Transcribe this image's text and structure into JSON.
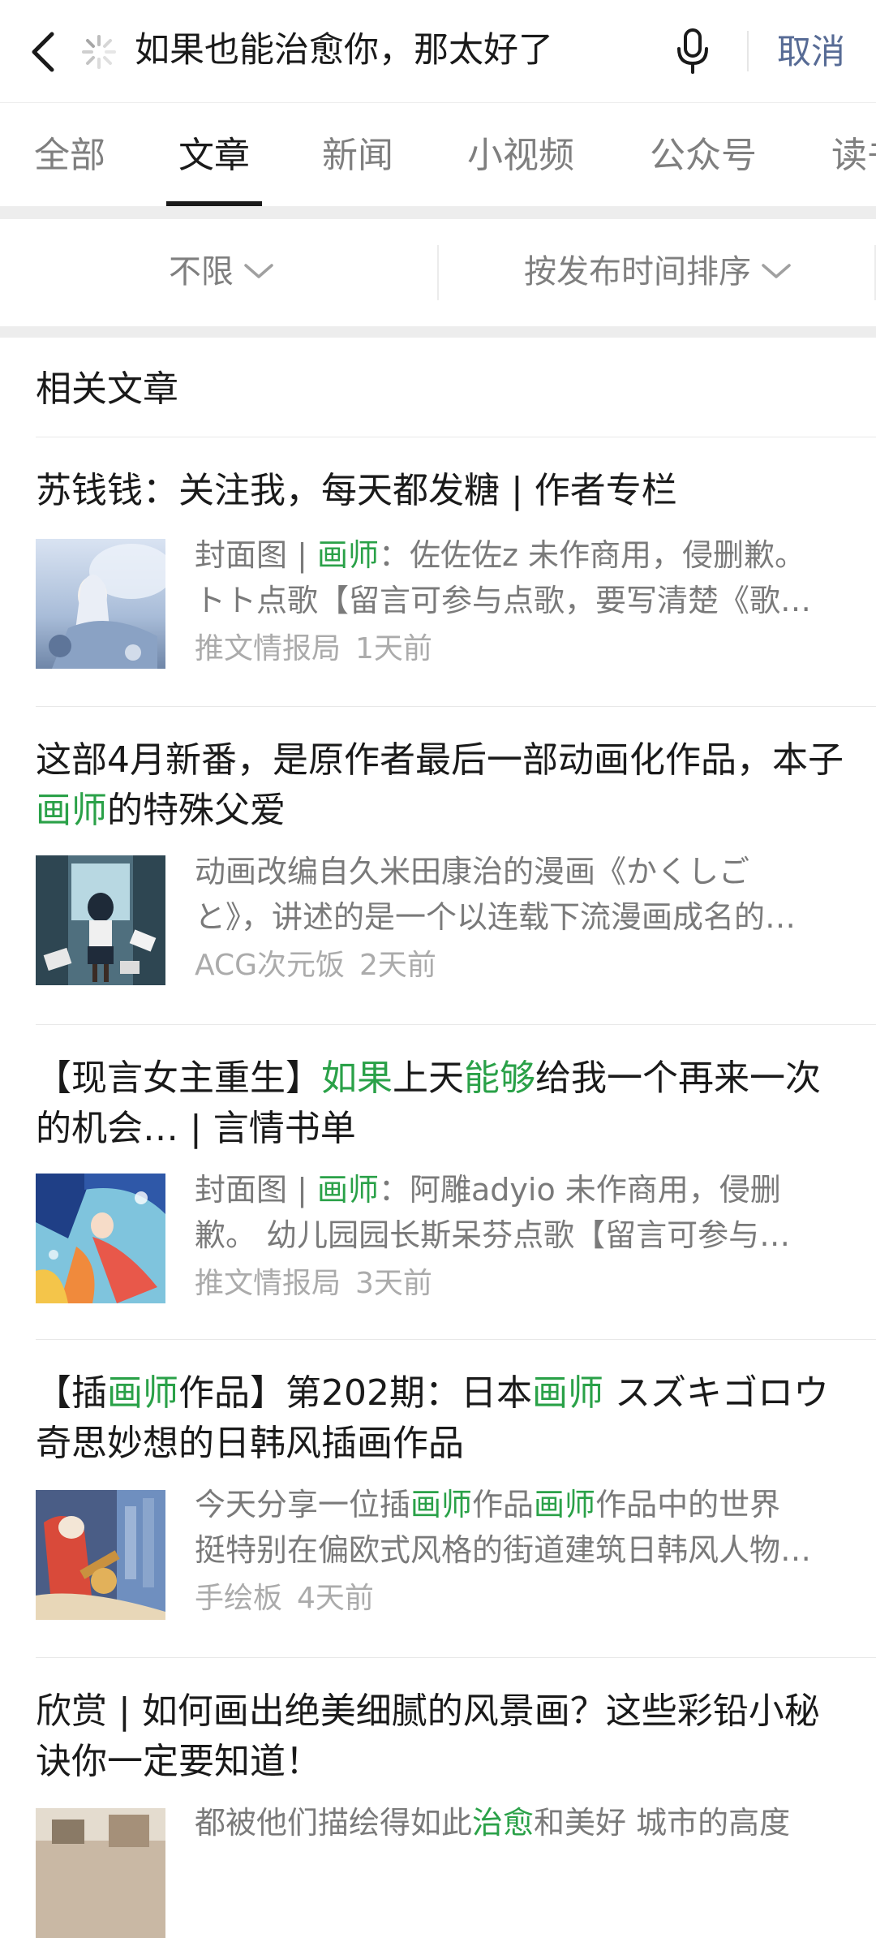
{
  "search": {
    "query": "如果也能治愈你，那太好了",
    "cancel_label": "取消"
  },
  "tabs": [
    {
      "label": "全部"
    },
    {
      "label": "文章"
    },
    {
      "label": "新闻"
    },
    {
      "label": "小视频"
    },
    {
      "label": "公众号"
    },
    {
      "label": "读书"
    }
  ],
  "active_tab": "文章",
  "filters": {
    "range_label": "不限",
    "sort_label": "按发布时间排序"
  },
  "section_title": "相关文章",
  "articles": [
    {
      "title_parts": [
        {
          "text": "苏钱钱：关注我，每天都发糖 | 作者专栏",
          "hl": false
        }
      ],
      "snippet_lines": [
        [
          {
            "text": "封面图 | ",
            "hl": false
          },
          {
            "text": "画师",
            "hl": true
          },
          {
            "text": "：佐佐佐z 未作商用，侵删歉。",
            "hl": false
          }
        ],
        [
          {
            "text": "トト点歌【留言可参与点歌，要写清楚《歌…",
            "hl": false
          }
        ]
      ],
      "source": "推文情报局",
      "time": "1天前"
    },
    {
      "title_parts": [
        {
          "text": "这部4月新番，是原作者最后一部动画化作品，本子",
          "hl": false
        },
        {
          "text": "画师",
          "hl": true
        },
        {
          "text": "的特殊父爱",
          "hl": false
        }
      ],
      "snippet_lines": [
        [
          {
            "text": "动画改编自久米田康治的漫画《かくしご",
            "hl": false
          }
        ],
        [
          {
            "text": "と》，讲述的是一个以连载下流漫画成名的…",
            "hl": false
          }
        ]
      ],
      "source": "ACG次元饭",
      "time": "2天前"
    },
    {
      "title_parts": [
        {
          "text": "【现言女主重生】",
          "hl": false
        },
        {
          "text": "如果",
          "hl": true
        },
        {
          "text": "上天",
          "hl": false
        },
        {
          "text": "能够",
          "hl": true
        },
        {
          "text": "给我一个再来一次的机会… | 言情书单",
          "hl": false
        }
      ],
      "snippet_lines": [
        [
          {
            "text": "封面图 | ",
            "hl": false
          },
          {
            "text": "画师",
            "hl": true
          },
          {
            "text": "：阿雕adyio 未作商用，侵删",
            "hl": false
          }
        ],
        [
          {
            "text": "歉。 幼儿园园长斯呆芬点歌【留言可参与…",
            "hl": false
          }
        ]
      ],
      "source": "推文情报局",
      "time": "3天前"
    },
    {
      "title_parts": [
        {
          "text": "【插",
          "hl": false
        },
        {
          "text": "画师",
          "hl": true
        },
        {
          "text": "作品】第202期：日本",
          "hl": false
        },
        {
          "text": "画师",
          "hl": true
        },
        {
          "text": " スズキゴロウ 奇思妙想的日韩风插画作品",
          "hl": false
        }
      ],
      "snippet_lines": [
        [
          {
            "text": "今天分享一位插",
            "hl": false
          },
          {
            "text": "画师",
            "hl": true
          },
          {
            "text": "作品",
            "hl": false
          },
          {
            "text": "画师",
            "hl": true
          },
          {
            "text": "作品中的世界",
            "hl": false
          }
        ],
        [
          {
            "text": "挺特别在偏欧式风格的街道建筑日韩风人物…",
            "hl": false
          }
        ]
      ],
      "source": "手绘板",
      "time": "4天前"
    },
    {
      "title_parts": [
        {
          "text": "欣赏 | 如何画出绝美细腻的风景画？这些彩铅小秘诀你一定要知道！",
          "hl": false
        }
      ],
      "snippet_lines": [
        [
          {
            "text": "都被他们描绘得如此",
            "hl": false
          },
          {
            "text": "治愈",
            "hl": true
          },
          {
            "text": "和美好 城市的高度",
            "hl": false
          }
        ]
      ],
      "source": "",
      "time": ""
    }
  ],
  "colors": {
    "highlight": "#2aa148",
    "link": "#576b95",
    "secondary_text": "#7a7a7a",
    "meta_text": "#ababab"
  }
}
